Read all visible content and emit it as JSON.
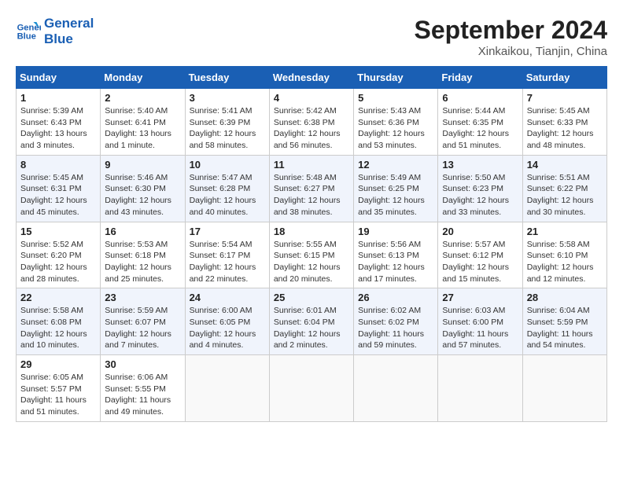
{
  "header": {
    "logo_line1": "General",
    "logo_line2": "Blue",
    "month_title": "September 2024",
    "subtitle": "Xinkaikou, Tianjin, China"
  },
  "weekdays": [
    "Sunday",
    "Monday",
    "Tuesday",
    "Wednesday",
    "Thursday",
    "Friday",
    "Saturday"
  ],
  "weeks": [
    [
      {
        "day": "1",
        "sunrise": "5:39 AM",
        "sunset": "6:43 PM",
        "daylight": "13 hours and 3 minutes."
      },
      {
        "day": "2",
        "sunrise": "5:40 AM",
        "sunset": "6:41 PM",
        "daylight": "13 hours and 1 minute."
      },
      {
        "day": "3",
        "sunrise": "5:41 AM",
        "sunset": "6:39 PM",
        "daylight": "12 hours and 58 minutes."
      },
      {
        "day": "4",
        "sunrise": "5:42 AM",
        "sunset": "6:38 PM",
        "daylight": "12 hours and 56 minutes."
      },
      {
        "day": "5",
        "sunrise": "5:43 AM",
        "sunset": "6:36 PM",
        "daylight": "12 hours and 53 minutes."
      },
      {
        "day": "6",
        "sunrise": "5:44 AM",
        "sunset": "6:35 PM",
        "daylight": "12 hours and 51 minutes."
      },
      {
        "day": "7",
        "sunrise": "5:45 AM",
        "sunset": "6:33 PM",
        "daylight": "12 hours and 48 minutes."
      }
    ],
    [
      {
        "day": "8",
        "sunrise": "5:45 AM",
        "sunset": "6:31 PM",
        "daylight": "12 hours and 45 minutes."
      },
      {
        "day": "9",
        "sunrise": "5:46 AM",
        "sunset": "6:30 PM",
        "daylight": "12 hours and 43 minutes."
      },
      {
        "day": "10",
        "sunrise": "5:47 AM",
        "sunset": "6:28 PM",
        "daylight": "12 hours and 40 minutes."
      },
      {
        "day": "11",
        "sunrise": "5:48 AM",
        "sunset": "6:27 PM",
        "daylight": "12 hours and 38 minutes."
      },
      {
        "day": "12",
        "sunrise": "5:49 AM",
        "sunset": "6:25 PM",
        "daylight": "12 hours and 35 minutes."
      },
      {
        "day": "13",
        "sunrise": "5:50 AM",
        "sunset": "6:23 PM",
        "daylight": "12 hours and 33 minutes."
      },
      {
        "day": "14",
        "sunrise": "5:51 AM",
        "sunset": "6:22 PM",
        "daylight": "12 hours and 30 minutes."
      }
    ],
    [
      {
        "day": "15",
        "sunrise": "5:52 AM",
        "sunset": "6:20 PM",
        "daylight": "12 hours and 28 minutes."
      },
      {
        "day": "16",
        "sunrise": "5:53 AM",
        "sunset": "6:18 PM",
        "daylight": "12 hours and 25 minutes."
      },
      {
        "day": "17",
        "sunrise": "5:54 AM",
        "sunset": "6:17 PM",
        "daylight": "12 hours and 22 minutes."
      },
      {
        "day": "18",
        "sunrise": "5:55 AM",
        "sunset": "6:15 PM",
        "daylight": "12 hours and 20 minutes."
      },
      {
        "day": "19",
        "sunrise": "5:56 AM",
        "sunset": "6:13 PM",
        "daylight": "12 hours and 17 minutes."
      },
      {
        "day": "20",
        "sunrise": "5:57 AM",
        "sunset": "6:12 PM",
        "daylight": "12 hours and 15 minutes."
      },
      {
        "day": "21",
        "sunrise": "5:58 AM",
        "sunset": "6:10 PM",
        "daylight": "12 hours and 12 minutes."
      }
    ],
    [
      {
        "day": "22",
        "sunrise": "5:58 AM",
        "sunset": "6:08 PM",
        "daylight": "12 hours and 10 minutes."
      },
      {
        "day": "23",
        "sunrise": "5:59 AM",
        "sunset": "6:07 PM",
        "daylight": "12 hours and 7 minutes."
      },
      {
        "day": "24",
        "sunrise": "6:00 AM",
        "sunset": "6:05 PM",
        "daylight": "12 hours and 4 minutes."
      },
      {
        "day": "25",
        "sunrise": "6:01 AM",
        "sunset": "6:04 PM",
        "daylight": "12 hours and 2 minutes."
      },
      {
        "day": "26",
        "sunrise": "6:02 AM",
        "sunset": "6:02 PM",
        "daylight": "11 hours and 59 minutes."
      },
      {
        "day": "27",
        "sunrise": "6:03 AM",
        "sunset": "6:00 PM",
        "daylight": "11 hours and 57 minutes."
      },
      {
        "day": "28",
        "sunrise": "6:04 AM",
        "sunset": "5:59 PM",
        "daylight": "11 hours and 54 minutes."
      }
    ],
    [
      {
        "day": "29",
        "sunrise": "6:05 AM",
        "sunset": "5:57 PM",
        "daylight": "11 hours and 51 minutes."
      },
      {
        "day": "30",
        "sunrise": "6:06 AM",
        "sunset": "5:55 PM",
        "daylight": "11 hours and 49 minutes."
      },
      null,
      null,
      null,
      null,
      null
    ]
  ],
  "labels": {
    "sunrise": "Sunrise:",
    "sunset": "Sunset:",
    "daylight": "Daylight:"
  }
}
